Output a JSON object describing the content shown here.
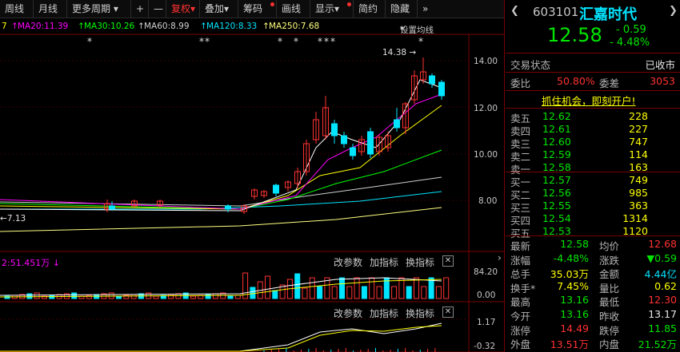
{
  "toolbar": {
    "items": [
      {
        "label": "周线"
      },
      {
        "label": "月线"
      },
      {
        "label": "更多周期"
      },
      {
        "label": "+"
      },
      {
        "label": "—"
      },
      {
        "label": "复权"
      },
      {
        "label": "叠加"
      },
      {
        "label": "筹码"
      },
      {
        "label": "画线"
      },
      {
        "label": "显示"
      },
      {
        "label": "简约"
      },
      {
        "label": "隐藏"
      },
      {
        "label": "»"
      }
    ]
  },
  "ma_legend": {
    "ma10_tail": "7",
    "ma20": "MA20:11.39",
    "ma30": "MA30:10.26",
    "ma60": "MA60:8.99",
    "ma120": "MA120:8.33",
    "ma250": "MA250:7.68",
    "settings": "设置均线"
  },
  "price_axis": {
    "labels": [
      "14.00",
      "12.00",
      "10.00",
      "8.00"
    ]
  },
  "annotations": {
    "high": "14.38",
    "low": "7.13"
  },
  "volume": {
    "header": "2:51.451万",
    "buttons": {
      "params": "改参数",
      "add": "加指标",
      "swap": "换指标"
    },
    "axis": [
      "84.20",
      "0.00"
    ]
  },
  "indicator": {
    "buttons": {
      "params": "改参数",
      "add": "加指标",
      "swap": "换指标"
    },
    "axis": [
      "1.17",
      "-0.32"
    ]
  },
  "stock": {
    "code": "603101",
    "name": "汇嘉时代",
    "price": "12.58",
    "change": "- 0.59",
    "change_pct": "- 4.48%",
    "status_label": "交易状态",
    "status_value": "已收市",
    "weibi_label": "委比",
    "weibi_value": "50.80%",
    "weicha_label": "委差",
    "weicha_value": "3053",
    "promo": "抓住机会，即刻开户!"
  },
  "asks": [
    {
      "label": "卖五",
      "price": "12.62",
      "vol": "228"
    },
    {
      "label": "卖四",
      "price": "12.61",
      "vol": "227"
    },
    {
      "label": "卖三",
      "price": "12.60",
      "vol": "747"
    },
    {
      "label": "卖二",
      "price": "12.59",
      "vol": "114"
    },
    {
      "label": "卖一",
      "price": "12.58",
      "vol": "163"
    }
  ],
  "bids": [
    {
      "label": "买一",
      "price": "12.57",
      "vol": "749"
    },
    {
      "label": "买二",
      "price": "12.56",
      "vol": "985"
    },
    {
      "label": "买三",
      "price": "12.55",
      "vol": "363"
    },
    {
      "label": "买四",
      "price": "12.54",
      "vol": "1314"
    },
    {
      "label": "买五",
      "price": "12.53",
      "vol": "1120"
    }
  ],
  "stats": [
    {
      "l1": "最新",
      "v1": "12.58",
      "l2": "均价",
      "v2": "12.68"
    },
    {
      "l1": "涨幅",
      "v1": "-4.48%",
      "l2": "涨跌",
      "v2": "▼0.59"
    },
    {
      "l1": "总手",
      "v1": "35.03万",
      "l2": "金额",
      "v2": "4.44亿"
    },
    {
      "l1": "换手*",
      "v1": "7.45%",
      "l2": "量比",
      "v2": "0.62"
    },
    {
      "l1": "最高",
      "v1": "13.16",
      "l2": "最低",
      "v2": "12.30"
    },
    {
      "l1": "今开",
      "v1": "13.16",
      "l2": "昨收",
      "v2": "13.17"
    },
    {
      "l1": "涨停",
      "v1": "14.49",
      "l2": "跌停",
      "v2": "11.85"
    },
    {
      "l1": "外盘",
      "v1": "13.51万",
      "l2": "内盘",
      "v2": "21.52万"
    }
  ],
  "colors": {
    "up": "#ff3232",
    "down": "#00e5ff",
    "ma5": "#ffffff",
    "ma10": "#ffff00",
    "ma20": "#ff00ff",
    "ma30": "#00ff00",
    "ma60": "#d0d0d0",
    "ma120": "#00e5ff",
    "ma250": "#ffff80"
  }
}
